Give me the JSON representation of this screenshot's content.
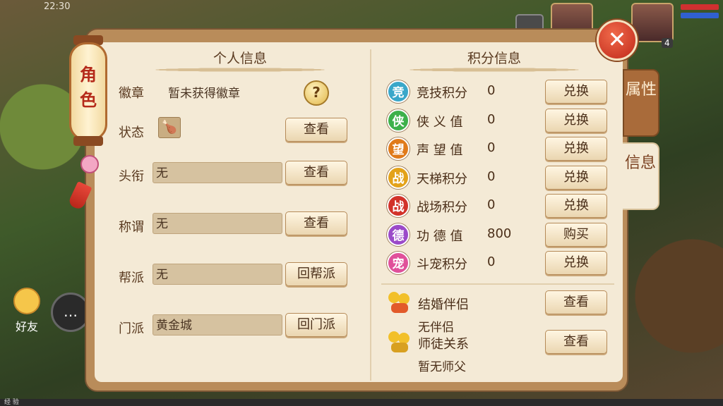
{
  "hud": {
    "time": "22:30",
    "level": "4",
    "friend_label": "好友",
    "exp_label": "经 验"
  },
  "lantern": {
    "char1": "角",
    "char2": "色"
  },
  "close_label": "✕",
  "side_tabs": [
    {
      "label": "属性",
      "active": false
    },
    {
      "label": "信息",
      "active": true
    }
  ],
  "left": {
    "title": "个人信息",
    "badge": {
      "label": "徽章",
      "value": "暂未获得徽章",
      "help": "?"
    },
    "status": {
      "label": "状态",
      "button": "查看"
    },
    "title_row": {
      "label": "头衔",
      "value": "无",
      "button": "查看"
    },
    "appellation": {
      "label": "称谓",
      "value": "无",
      "button": "查看"
    },
    "faction": {
      "label": "帮派",
      "value": "无",
      "button": "回帮派"
    },
    "sect": {
      "label": "门派",
      "value": "黄金城",
      "button": "回门派"
    }
  },
  "right": {
    "title": "积分信息",
    "scores": [
      {
        "icon": "竞",
        "color": "#3aa7c9",
        "label": "竞技积分",
        "value": "0",
        "button": "兑换"
      },
      {
        "icon": "侠",
        "color": "#3db04a",
        "label": "侠 义 值",
        "value": "0",
        "button": "兑换"
      },
      {
        "icon": "望",
        "color": "#e07a1a",
        "label": "声 望 值",
        "value": "0",
        "button": "兑换"
      },
      {
        "icon": "战",
        "color": "#e3a21a",
        "label": "天梯积分",
        "value": "0",
        "button": "兑换"
      },
      {
        "icon": "战",
        "color": "#d2322a",
        "label": "战场积分",
        "value": "0",
        "button": "兑换"
      },
      {
        "icon": "德",
        "color": "#9b4ac9",
        "label": "功 德 值",
        "value": "800",
        "button": "购买"
      },
      {
        "icon": "宠",
        "color": "#e0509a",
        "label": "斗宠积分",
        "value": "0",
        "button": "兑换"
      }
    ],
    "marriage": {
      "label": "结婚伴侣",
      "value": "无伴侣",
      "button": "查看"
    },
    "mentor": {
      "label": "师徒关系",
      "value": "暂无师父",
      "button": "查看"
    }
  }
}
